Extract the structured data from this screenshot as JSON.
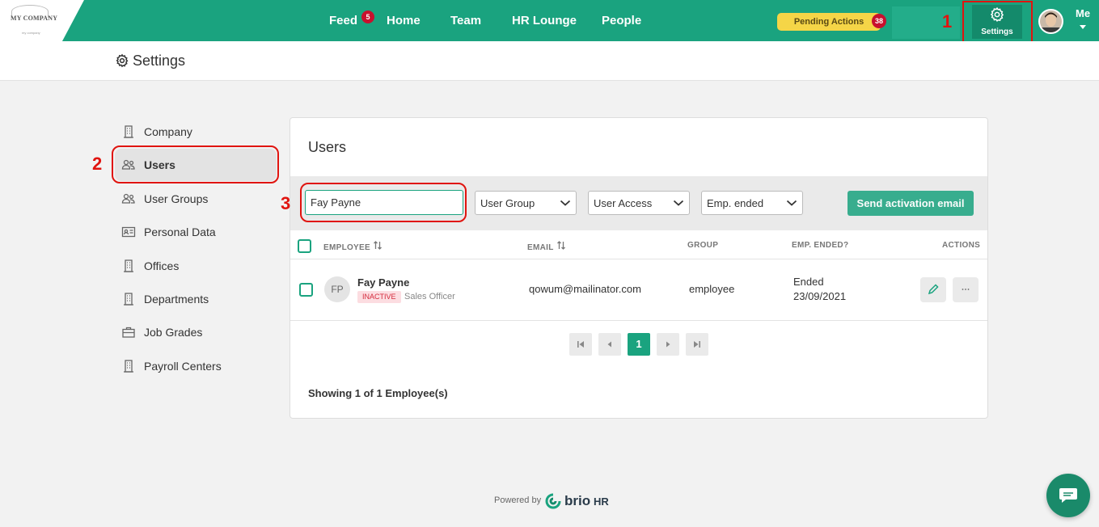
{
  "brand": {
    "logo_text": "MY COMPANY",
    "logo_sub": "my company",
    "accent": "#1aa37f",
    "powered_by": "Powered by",
    "product": "brio",
    "product_suffix": "HR"
  },
  "nav": {
    "items": [
      {
        "label": "Feed",
        "badge": "5"
      },
      {
        "label": "Home"
      },
      {
        "label": "Team"
      },
      {
        "label": "HR Lounge"
      },
      {
        "label": "People"
      }
    ],
    "pending_label": "Pending Actions",
    "pending_count": "38",
    "settings_label": "Settings",
    "me_label": "Me"
  },
  "annotations": [
    "1",
    "2",
    "3"
  ],
  "page": {
    "title": "Settings"
  },
  "sidebar": {
    "items": [
      {
        "label": "Company",
        "icon": "building-icon"
      },
      {
        "label": "Users",
        "icon": "users-icon",
        "active": true
      },
      {
        "label": "User Groups",
        "icon": "user-groups-icon"
      },
      {
        "label": "Personal Data",
        "icon": "id-card-icon"
      },
      {
        "label": "Offices",
        "icon": "building-icon"
      },
      {
        "label": "Departments",
        "icon": "building-icon"
      },
      {
        "label": "Job Grades",
        "icon": "briefcase-icon"
      },
      {
        "label": "Payroll Centers",
        "icon": "building-icon"
      }
    ]
  },
  "users": {
    "title": "Users",
    "search_value": "Fay Payne",
    "filters": [
      "User Group",
      "User Access",
      "Emp. ended"
    ],
    "send_button": "Send activation email",
    "columns": [
      "EMPLOYEE",
      "EMAIL",
      "GROUP",
      "EMP. ENDED?",
      "ACTIONS"
    ],
    "rows": [
      {
        "initials": "FP",
        "name": "Fay Payne",
        "status": "INACTIVE",
        "role": "Sales Officer",
        "email": "qowum@mailinator.com",
        "group": "employee",
        "ended_label": "Ended",
        "ended_date": "23/09/2021"
      }
    ],
    "pagination": {
      "current": "1"
    },
    "showing": "Showing 1 of 1 Employee(s)"
  }
}
